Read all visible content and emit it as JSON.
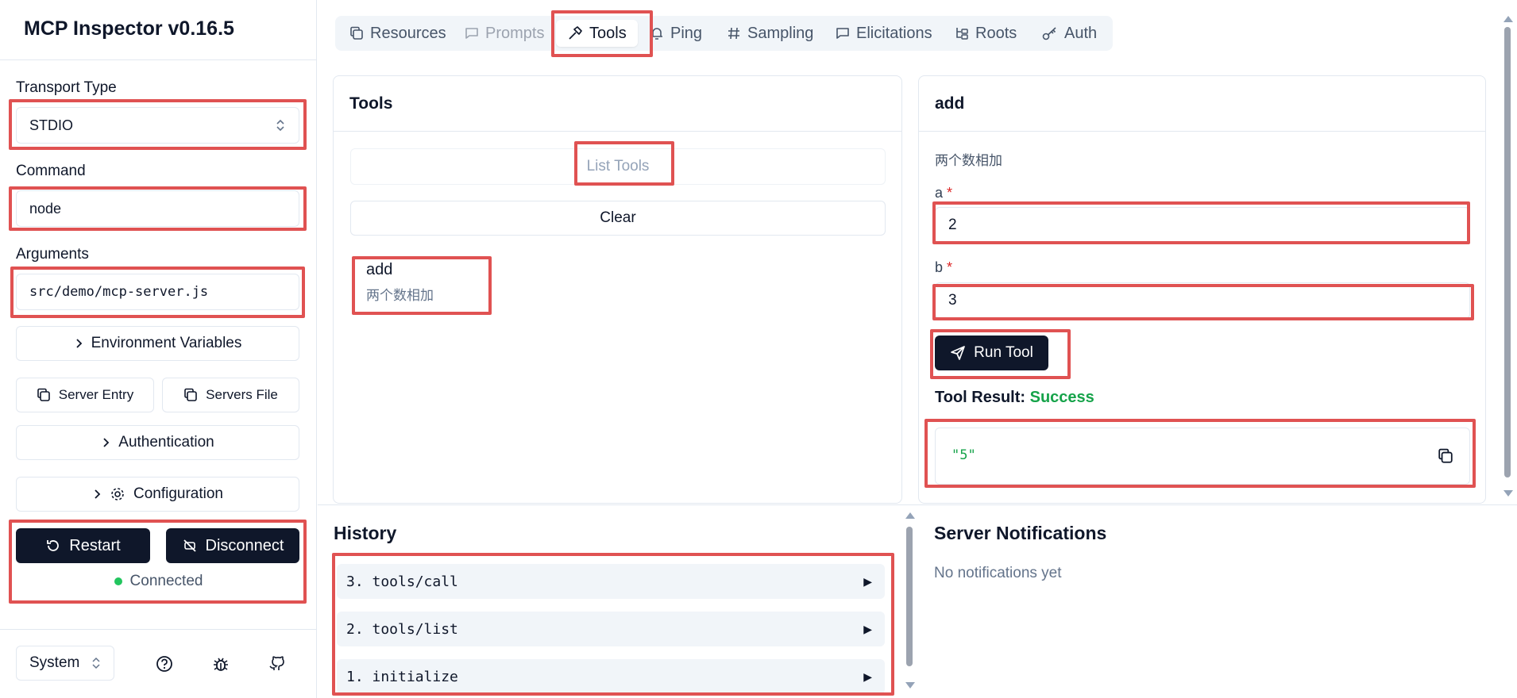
{
  "app": {
    "title": "MCP Inspector v0.16.5"
  },
  "sidebar": {
    "transport_label": "Transport Type",
    "transport_value": "STDIO",
    "command_label": "Command",
    "command_value": "node",
    "arguments_label": "Arguments",
    "arguments_value": "src/demo/mcp-server.js",
    "env_vars": "Environment Variables",
    "server_entry": "Server Entry",
    "servers_file": "Servers File",
    "authentication": "Authentication",
    "configuration": "Configuration",
    "restart": "Restart",
    "disconnect": "Disconnect",
    "status": "Connected",
    "theme": "System"
  },
  "tabs": [
    {
      "label": "Resources",
      "icon": "copy-icon",
      "state": "normal"
    },
    {
      "label": "Prompts",
      "icon": "message-icon",
      "state": "disabled"
    },
    {
      "label": "Tools",
      "icon": "hammer-icon",
      "state": "active"
    },
    {
      "label": "Ping",
      "icon": "bell-icon",
      "state": "normal"
    },
    {
      "label": "Sampling",
      "icon": "hash-icon",
      "state": "normal"
    },
    {
      "label": "Elicitations",
      "icon": "message-icon",
      "state": "normal"
    },
    {
      "label": "Roots",
      "icon": "folder-tree-icon",
      "state": "normal"
    },
    {
      "label": "Auth",
      "icon": "key-icon",
      "state": "normal"
    }
  ],
  "tools_panel": {
    "title": "Tools",
    "list_tools": "List Tools",
    "clear": "Clear",
    "items": [
      {
        "name": "add",
        "description": "两个数相加"
      }
    ]
  },
  "detail_panel": {
    "title": "add",
    "description": "两个数相加",
    "param_a_label": "a",
    "param_a_value": "2",
    "param_b_label": "b",
    "param_b_value": "3",
    "required_marker": "*",
    "run_tool": "Run Tool",
    "result_label": "Tool Result:",
    "result_status": "Success",
    "result_value": "\"5\""
  },
  "history": {
    "title": "History",
    "items": [
      {
        "label": "3. tools/call",
        "arrow": "▶"
      },
      {
        "label": "2. tools/list",
        "arrow": "▶"
      },
      {
        "label": "1. initialize",
        "arrow": "▶"
      }
    ]
  },
  "notifications": {
    "title": "Server Notifications",
    "empty": "No notifications yet"
  },
  "colors": {
    "highlight": "#e05252",
    "dark_button": "#0f172a",
    "success": "#16a34a",
    "connected": "#22c55e"
  }
}
